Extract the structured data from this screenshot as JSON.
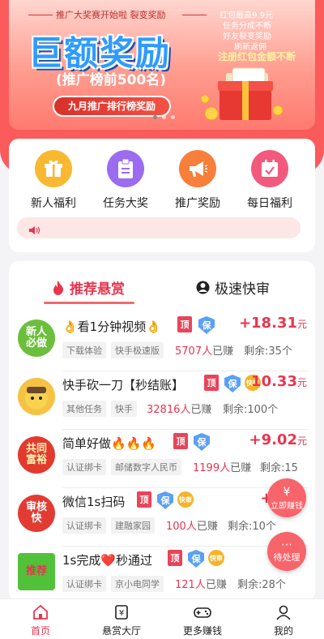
{
  "banner": {
    "subtitle_top": "推广大奖赛开始啦  裂变奖励",
    "headline": "巨额奖励",
    "rank_text": "(推广榜前500名)",
    "pill_text": "九月推广排行榜奖励",
    "right_lines": [
      "红包最高9.9元",
      "任务分成不断",
      "好友裂变奖励",
      "刷新返佣"
    ],
    "right_highlight": "注册红包金额不断"
  },
  "categories": [
    {
      "label": "新人福利",
      "icon": "gift-icon",
      "color": "#f8b830"
    },
    {
      "label": "任务大奖",
      "icon": "clipboard-icon",
      "color": "#9b6cf0"
    },
    {
      "label": "推广奖励",
      "icon": "megaphone-icon",
      "color": "#f77f3a"
    },
    {
      "label": "每日福利",
      "icon": "calendar-check-icon",
      "color": "#f25a7d"
    }
  ],
  "tabs": [
    {
      "label": "推荐悬赏",
      "icon": "flame-icon",
      "active": true
    },
    {
      "label": "极速快审",
      "icon": "user-icon",
      "active": false
    }
  ],
  "tasks": [
    {
      "thumb_text": "新人必做",
      "title": "👌看1分钟视频👌",
      "tags": [
        "下载体验",
        "快手极速版"
      ],
      "count": "5707人",
      "count_suffix": "已赚",
      "remaining": "剩余:35个",
      "price": "+18.31",
      "unit": "元",
      "badges": [
        "顶",
        "保"
      ]
    },
    {
      "thumb_text": "",
      "title": "快手砍一刀【秒结账】",
      "tags": [
        "其他任务",
        "快手"
      ],
      "count": "32816人",
      "count_suffix": "已赚",
      "remaining": "剩余:100个",
      "price": "10.33",
      "unit": "元",
      "badges": [
        "顶",
        "保",
        "快审"
      ]
    },
    {
      "thumb_text": "共同富裕",
      "title": "简单好做🔥🔥🔥",
      "tags": [
        "认证绑卡",
        "邮储数字人民币"
      ],
      "count": "1199人",
      "count_suffix": "已赚",
      "remaining": "剩余:15",
      "price": "+9.02",
      "unit": "元",
      "badges": [
        "顶",
        "保"
      ]
    },
    {
      "thumb_text": "审核快",
      "title": "微信1s扫码",
      "tags": [
        "认证绑卡",
        "建融家园"
      ],
      "count": "100人",
      "count_suffix": "已赚",
      "remaining": "剩余:10个",
      "price": "+2",
      "unit": "",
      "badges": [
        "顶",
        "保",
        "快审"
      ]
    },
    {
      "thumb_text": "推荐",
      "title": "1s完成❤️秒通过",
      "tags": [
        "认证绑卡",
        "京小电同学"
      ],
      "count": "121人",
      "count_suffix": "已赚",
      "remaining": "剩余:28个",
      "price": "",
      "unit": "",
      "badges": [
        "顶",
        "保",
        "快审"
      ]
    }
  ],
  "floating": {
    "earn": "立即赚钱",
    "pending": "待处理"
  },
  "nav": [
    {
      "label": "首页",
      "icon": "home-icon",
      "active": true
    },
    {
      "label": "悬赏大厅",
      "icon": "reward-hall-icon",
      "active": false
    },
    {
      "label": "更多赚钱",
      "icon": "gamepad-icon",
      "active": false
    },
    {
      "label": "我的",
      "icon": "profile-icon",
      "active": false
    }
  ],
  "colors": {
    "accent": "#e8364f",
    "header_bg": "#fb5b5b"
  }
}
